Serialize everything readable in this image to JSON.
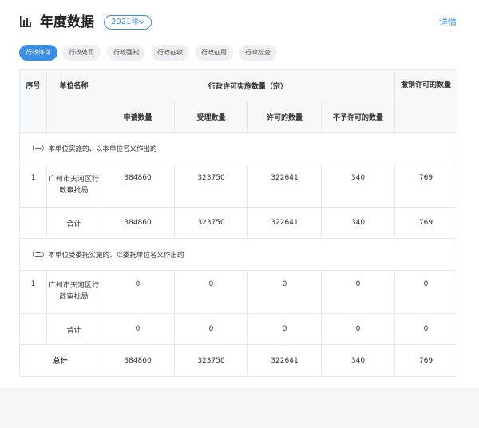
{
  "header": {
    "title": "年度数据",
    "year_select": "2021年",
    "details_link": "详情"
  },
  "tabs": [
    {
      "label": "行政许可",
      "active": true
    },
    {
      "label": "行政处罚",
      "active": false
    },
    {
      "label": "行政强制",
      "active": false
    },
    {
      "label": "行政征收",
      "active": false
    },
    {
      "label": "行政征用",
      "active": false
    },
    {
      "label": "行政检查",
      "active": false
    }
  ],
  "table": {
    "headers": {
      "index": "序号",
      "unit_name": "单位名称",
      "group": "行政许可实施数量（宗）",
      "revoke": "撤销许可的数量",
      "applied": "申请数量",
      "accepted": "受理数量",
      "permitted": "许可的数量",
      "denied": "不予许可的数量"
    },
    "section1": {
      "label": "（一）本单位实施的、以本单位名义作出的",
      "row": {
        "index": "1",
        "unit": "广州市天河区行政审批局",
        "applied": "384860",
        "accepted": "323750",
        "permitted": "322641",
        "denied": "340",
        "revoke": "769"
      },
      "subtotal": {
        "label": "合计",
        "applied": "384860",
        "accepted": "323750",
        "permitted": "322641",
        "denied": "340",
        "revoke": "769"
      }
    },
    "section2": {
      "label": "（二）本单位受委托实施的、以委托单位名义作出的",
      "row": {
        "index": "1",
        "unit": "广州市天河区行政审批局",
        "applied": "0",
        "accepted": "0",
        "permitted": "0",
        "denied": "0",
        "revoke": "0"
      },
      "subtotal": {
        "label": "合计",
        "applied": "0",
        "accepted": "0",
        "permitted": "0",
        "denied": "0",
        "revoke": "0"
      }
    },
    "total": {
      "label": "总计",
      "applied": "384860",
      "accepted": "323750",
      "permitted": "322641",
      "denied": "340",
      "revoke": "769"
    }
  },
  "colors": {
    "accent": "#3a8ee6",
    "border": "#e6e8eb",
    "header_bg": "#f7f8fa"
  }
}
